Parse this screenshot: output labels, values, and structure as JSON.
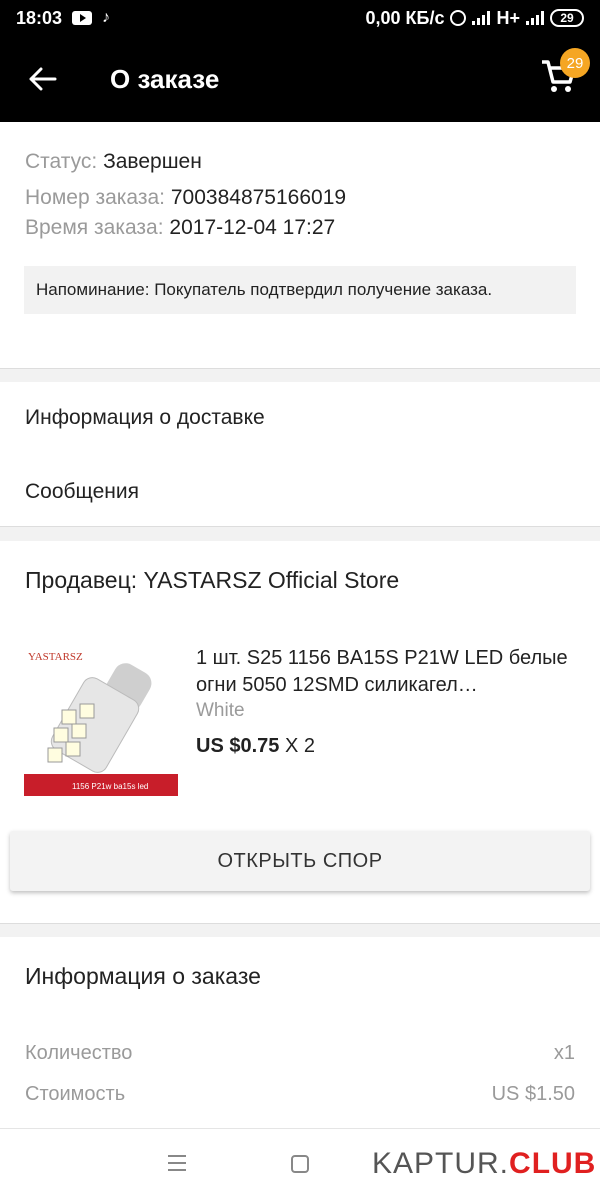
{
  "status_bar": {
    "time": "18:03",
    "network_speed": "0,00 КБ/с",
    "network_type": "H+",
    "battery": "29"
  },
  "app_bar": {
    "title": "О заказе",
    "cart_count": "29"
  },
  "order": {
    "status_label": "Статус:",
    "status_value": "Завершен",
    "number_label": "Номер заказа:",
    "number_value": "700384875166019",
    "time_label": "Время заказа:",
    "time_value": "2017-12-04 17:27",
    "reminder": "Напоминание: Покупатель подтвердил получение заказа."
  },
  "links": {
    "delivery": "Информация о доставке",
    "messages": "Сообщения"
  },
  "seller": {
    "label": "Продавец: YASTARSZ Official Store",
    "product": {
      "title": "1 шт. S25 1156 BA15S P21W LED белые огни 5050 12SMD силикагел…",
      "variant": "White",
      "price": "US $0.75",
      "qty": " X 2",
      "image_brand": "YASTARSZ",
      "image_caption": "1156 P21w ba15s led"
    },
    "dispute_button": "ОТКРЫТЬ СПОР"
  },
  "order_info": {
    "title": "Информация о заказе",
    "quantity_label": "Количество",
    "quantity_value": "x1",
    "cost_label": "Стоимость",
    "cost_value": "US $1.50"
  },
  "watermark": {
    "main": "KAPTUR.",
    "accent": "CLUB"
  },
  "colors": {
    "bar": "#000000",
    "badge": "#f5a623",
    "accent_red": "#e02020"
  }
}
